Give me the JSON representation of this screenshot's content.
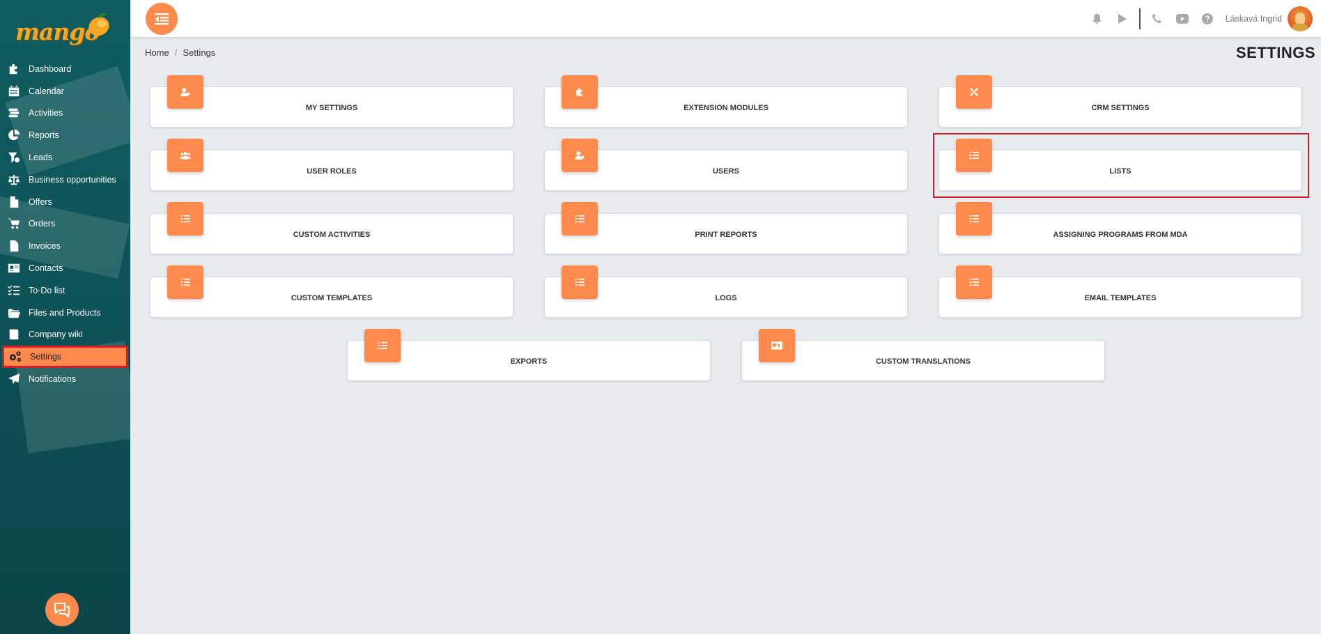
{
  "app": {
    "logo_text": "mango"
  },
  "sidebar": {
    "items": [
      {
        "label": "Dashboard",
        "icon": "puzzle-icon"
      },
      {
        "label": "Calendar",
        "icon": "calendar-icon"
      },
      {
        "label": "Activities",
        "icon": "activities-icon"
      },
      {
        "label": "Reports",
        "icon": "pie-chart-icon"
      },
      {
        "label": "Leads",
        "icon": "funnel-icon"
      },
      {
        "label": "Business opportunities",
        "icon": "scales-icon"
      },
      {
        "label": "Offers",
        "icon": "document-icon"
      },
      {
        "label": "Orders",
        "icon": "cart-icon"
      },
      {
        "label": "Invoices",
        "icon": "invoice-icon"
      },
      {
        "label": "Contacts",
        "icon": "contact-card-icon"
      },
      {
        "label": "To-Do list",
        "icon": "checklist-icon"
      },
      {
        "label": "Files and Products",
        "icon": "folder-icon"
      },
      {
        "label": "Company wiki",
        "icon": "book-icon"
      },
      {
        "label": "Settings",
        "icon": "gears-icon",
        "active": true
      },
      {
        "label": "Notifications",
        "icon": "paper-plane-icon"
      }
    ]
  },
  "topbar": {
    "username": "Láskavá Ingrid"
  },
  "breadcrumb": {
    "home": "Home",
    "separator": "/",
    "current": "Settings"
  },
  "page": {
    "title": "SETTINGS"
  },
  "cards": [
    {
      "label": "MY SETTINGS",
      "icon": "user-cog-icon"
    },
    {
      "label": "EXTENSION MODULES",
      "icon": "puzzle-icon"
    },
    {
      "label": "CRM SETTINGS",
      "icon": "tools-icon"
    },
    {
      "label": "USER ROLES",
      "icon": "users-icon"
    },
    {
      "label": "USERS",
      "icon": "user-cog-icon"
    },
    {
      "label": "LISTS",
      "icon": "list-icon",
      "highlighted": true
    },
    {
      "label": "CUSTOM ACTIVITIES",
      "icon": "list-icon"
    },
    {
      "label": "PRINT REPORTS",
      "icon": "list-icon"
    },
    {
      "label": "ASSIGNING PROGRAMS FROM MDA",
      "icon": "list-icon"
    },
    {
      "label": "CUSTOM TEMPLATES",
      "icon": "list-icon"
    },
    {
      "label": "LOGS",
      "icon": "list-icon"
    },
    {
      "label": "EMAIL TEMPLATES",
      "icon": "list-icon"
    },
    {
      "label": "EXPORTS",
      "icon": "list-icon"
    },
    {
      "label": "CUSTOM TRANSLATIONS",
      "icon": "language-icon"
    }
  ],
  "colors": {
    "accent": "#ff8a4c",
    "sidebar": "#0d5357",
    "highlight_border": "#d91a2a",
    "background": "#e9ecef"
  }
}
